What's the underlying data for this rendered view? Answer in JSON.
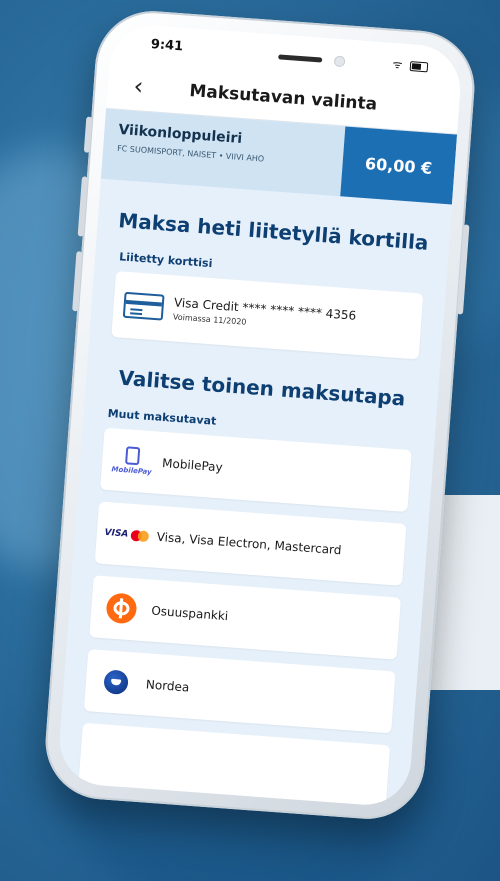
{
  "status": {
    "time": "9:41"
  },
  "nav": {
    "title": "Maksutavan valinta"
  },
  "summary": {
    "title": "Viikonloppuleiri",
    "subtitle": "FC SUOMISPORT, NAISET • VIIVI AHO",
    "amount": "60,00 €"
  },
  "linked": {
    "heading": "Maksa heti liitetyllä kortilla",
    "label": "Liitetty korttisi",
    "card_name": "Visa Credit **** **** **** 4356",
    "card_validity": "Voimassa 11/2020"
  },
  "other": {
    "heading": "Valitse toinen maksutapa",
    "label": "Muut maksutavat",
    "methods": [
      {
        "label": "MobilePay",
        "icon": "mobilepay-icon"
      },
      {
        "label": "Visa, Visa Electron, Mastercard",
        "icon": "visa-mastercard-icon"
      },
      {
        "label": "Osuuspankki",
        "icon": "osuuspankki-icon"
      },
      {
        "label": "Nordea",
        "icon": "nordea-icon"
      }
    ]
  },
  "logos": {
    "mobilepay": "MobilePay",
    "visa": "VISA"
  },
  "colors": {
    "primary": "#1d6fb4",
    "heading": "#0e3f73",
    "screen_bg": "#e6f0fa"
  }
}
